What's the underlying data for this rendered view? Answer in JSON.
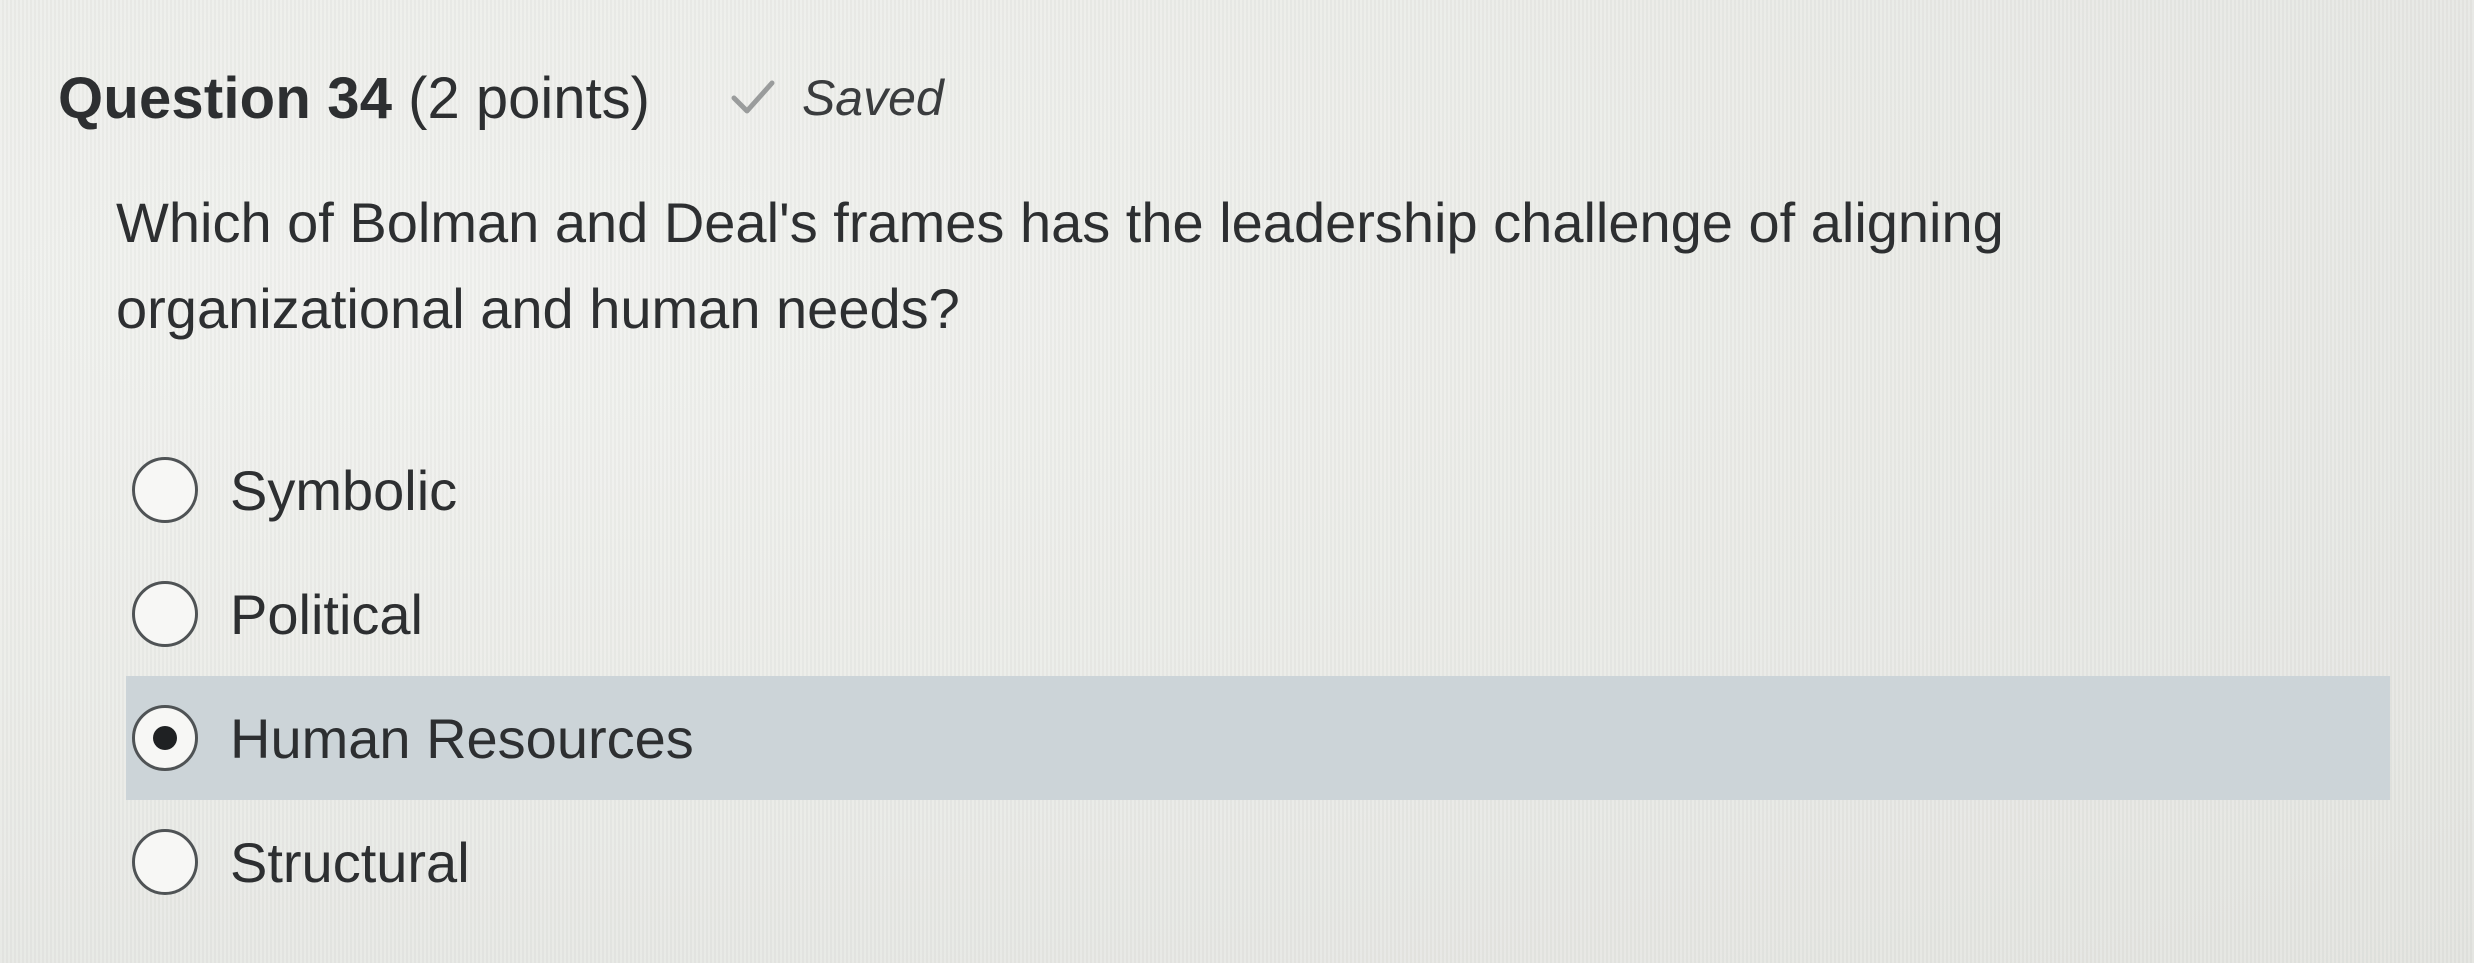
{
  "question": {
    "title": "Question 34",
    "points": "(2 points)",
    "status": {
      "icon": "check-icon",
      "label": "Saved"
    },
    "text": "Which of Bolman and Deal's frames has the leadership challenge of aligning organizational and human needs?"
  },
  "options": [
    {
      "label": "Symbolic",
      "selected": false
    },
    {
      "label": "Political",
      "selected": false
    },
    {
      "label": "Human Resources",
      "selected": true
    },
    {
      "label": "Structural",
      "selected": false
    }
  ],
  "colors": {
    "selected_background": "#ccd4d8",
    "text": "#2d2f31",
    "check": "#9a9c9c"
  }
}
